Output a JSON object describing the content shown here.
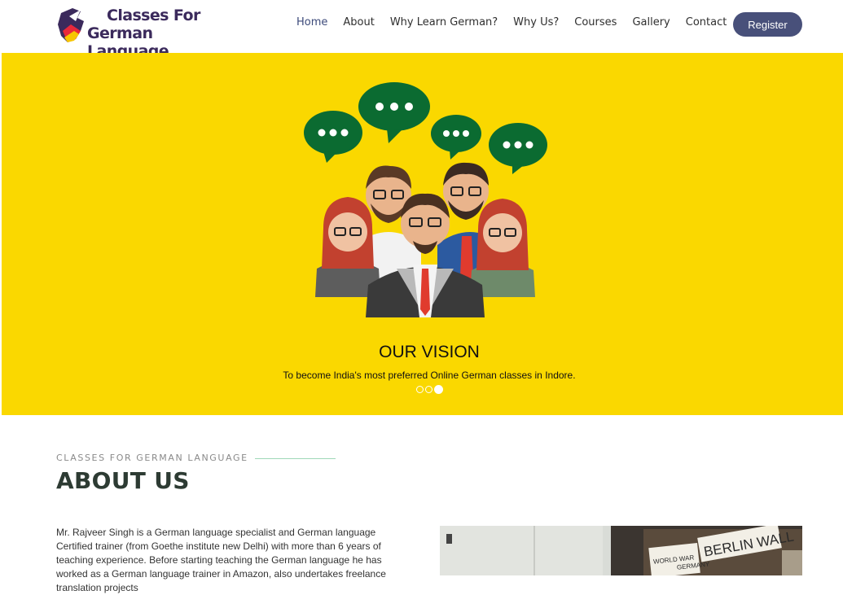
{
  "brand": {
    "line1": "Classes For",
    "line2": "German Language"
  },
  "nav": {
    "items": [
      "Home",
      "About",
      "Why Learn German?",
      "Why Us?",
      "Courses",
      "Gallery",
      "Contact"
    ],
    "register_label": "Register"
  },
  "hero": {
    "title": "OUR VISION",
    "subtitle": "To become India's most preferred Online German classes in Indore.",
    "slides": 3,
    "active_slide": 3
  },
  "about": {
    "eyebrow": "CLASSES FOR GERMAN LANGUAGE",
    "title": "ABOUT US",
    "paragraph": "Mr. Rajveer Singh is a German language specialist and German language Certified trainer (from Goethe institute new Delhi) with more than 6 years of teaching experience. Before starting teaching the German language he has worked as a German language trainer in Amazon, also undertakes freelance translation projects",
    "photo_sign_1": "BERLIN WALL",
    "photo_sign_2": "WORLD WAR",
    "photo_sign_3": "GERMANY"
  },
  "colors": {
    "hero_bg": "#fad800",
    "register_bg": "#48507a",
    "accent_line": "#9fd8b8"
  },
  "icons": [
    "speech-bubble-icon",
    "logo-mark-icon"
  ]
}
